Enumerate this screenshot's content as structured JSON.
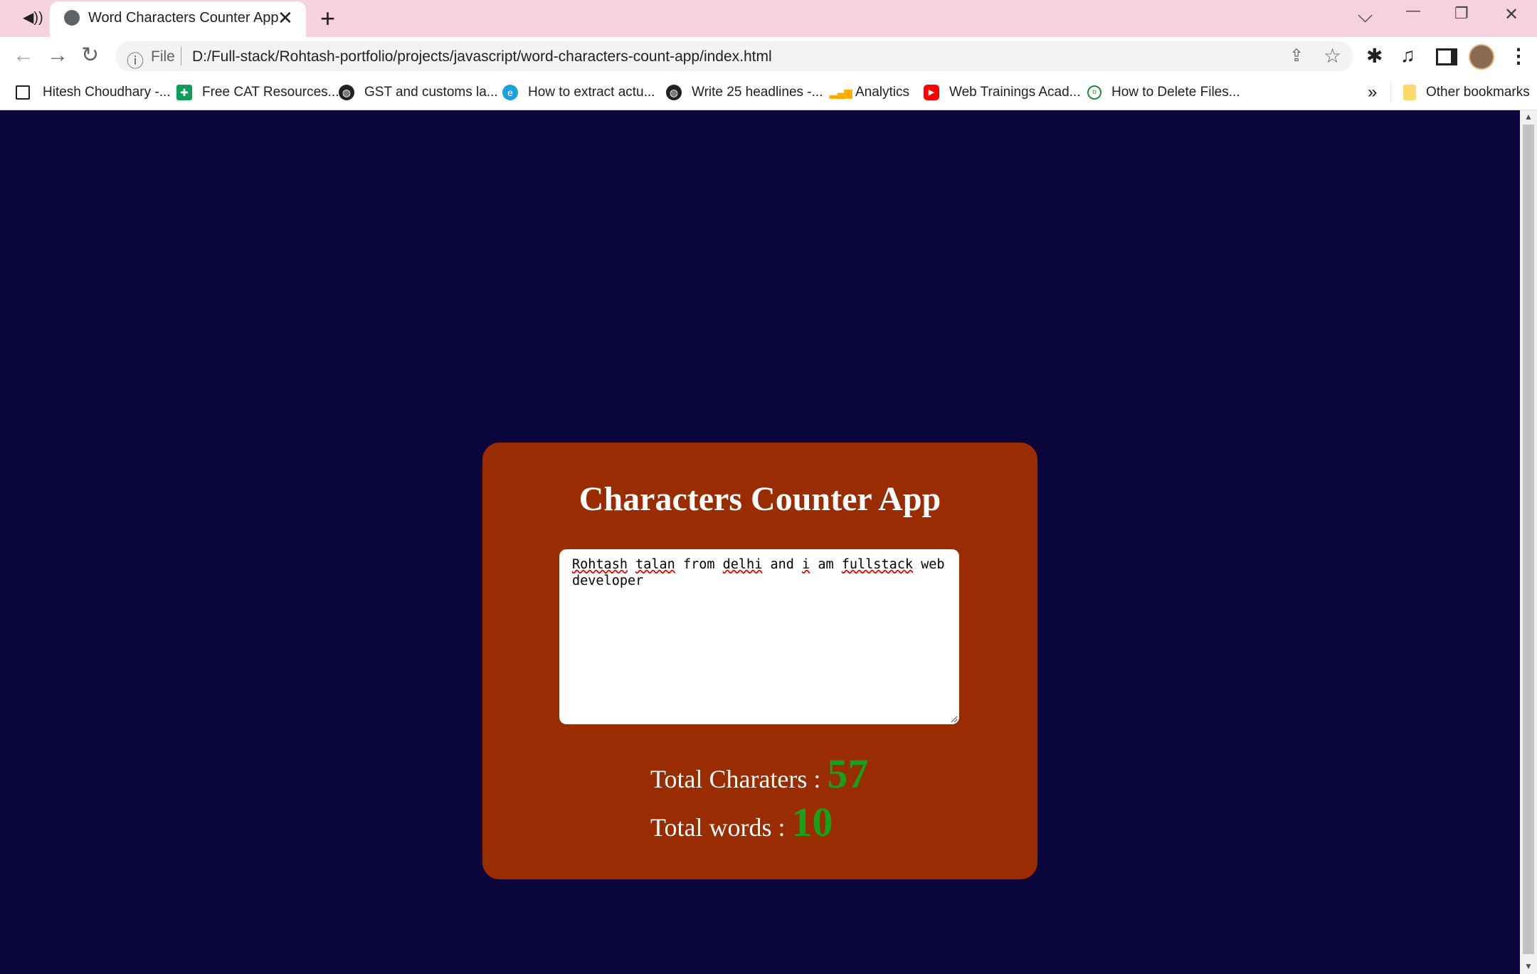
{
  "browser": {
    "tab": {
      "title": "Word Characters Counter App",
      "close": "✕"
    },
    "new_tab": "+",
    "window_controls": {
      "tabsearch": "⌵",
      "minimize": "—",
      "restore": "❐",
      "close": "✕"
    },
    "nav": {
      "back": "←",
      "forward": "→",
      "reload": "↻"
    },
    "address": {
      "scheme_label": "File",
      "url": "D:/Full-stack/Rohtash-portfolio/projects/javascript/word-characters-count-app/index.html"
    },
    "bookmarks": [
      {
        "label": "Hitesh Choudhary -...",
        "icon": "checkbox-icon"
      },
      {
        "label": "Free CAT Resources...",
        "icon": "sheets-icon"
      },
      {
        "label": "GST and customs la...",
        "icon": "globe-icon"
      },
      {
        "label": "How to extract actu...",
        "icon": "edge-icon"
      },
      {
        "label": "Write 25 headlines -...",
        "icon": "globe-icon"
      },
      {
        "label": "Analytics",
        "icon": "analytics-icon"
      },
      {
        "label": "Web Trainings Acad...",
        "icon": "youtube-icon"
      },
      {
        "label": "How to Delete Files...",
        "icon": "web-icon"
      }
    ],
    "more_bookmarks": "»",
    "other_bookmarks": "Other bookmarks"
  },
  "app": {
    "title": "Characters Counter App",
    "textarea_value": "Rohtash talan from delhi and i am fullstack web developer",
    "textarea_line1": [
      "Rohtash",
      " ",
      "talan",
      " from ",
      "delhi",
      " and ",
      "i",
      " am ",
      "fullstack",
      " web"
    ],
    "textarea_line2": "developer",
    "characters_label": "Total Charaters :",
    "characters_value": "57",
    "words_label": "Total words :",
    "words_value": "10"
  },
  "colors": {
    "page_background": "#0b063b",
    "card_background": "#992c00",
    "count_color": "#19a019",
    "tabstrip": "#f6d2e1"
  }
}
